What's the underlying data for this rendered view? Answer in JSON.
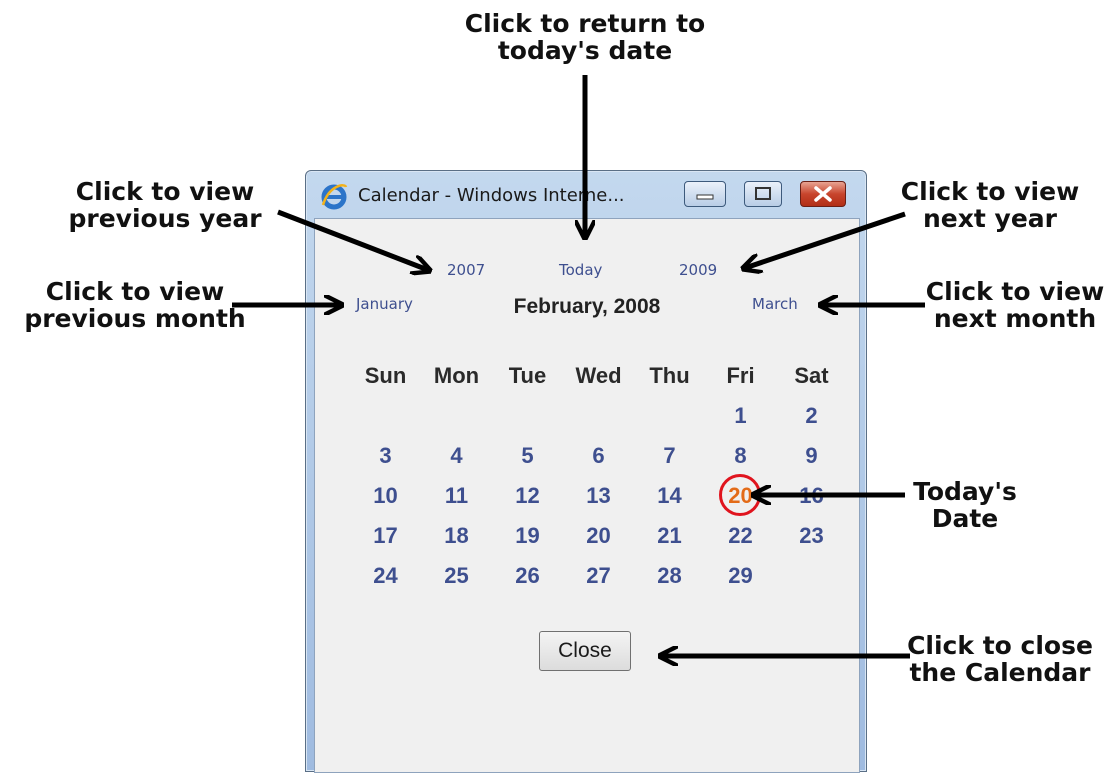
{
  "annotations": {
    "today": "Click to return to\ntoday's date",
    "prev_year": "Click to view\nprevious year",
    "next_year": "Click to view\nnext year",
    "prev_month": "Click to view\nprevious month",
    "next_month": "Click to view\nnext month",
    "todays_date": "Today's\nDate",
    "close": "Click to close\nthe Calendar"
  },
  "window": {
    "title": "Calendar - Windows Interne...",
    "icon": "ie-icon"
  },
  "nav": {
    "prev_year": "2007",
    "today": "Today",
    "next_year": "2009",
    "prev_month": "January",
    "month_title": "February, 2008",
    "next_month": "March"
  },
  "calendar": {
    "weekdays": [
      "Sun",
      "Mon",
      "Tue",
      "Wed",
      "Thu",
      "Fri",
      "Sat"
    ],
    "weeks": [
      [
        "",
        "",
        "",
        "",
        "",
        "1",
        "2"
      ],
      [
        "3",
        "4",
        "5",
        "6",
        "7",
        "8",
        "9"
      ],
      [
        "10",
        "11",
        "12",
        "13",
        "14",
        "20",
        "16"
      ],
      [
        "17",
        "18",
        "19",
        "20",
        "21",
        "22",
        "23"
      ],
      [
        "24",
        "25",
        "26",
        "27",
        "28",
        "29",
        ""
      ]
    ],
    "today": "20"
  },
  "close_label": "Close",
  "colors": {
    "link": "#3e4f8f",
    "today_text": "#e36b18",
    "today_ring": "#e0141e"
  }
}
